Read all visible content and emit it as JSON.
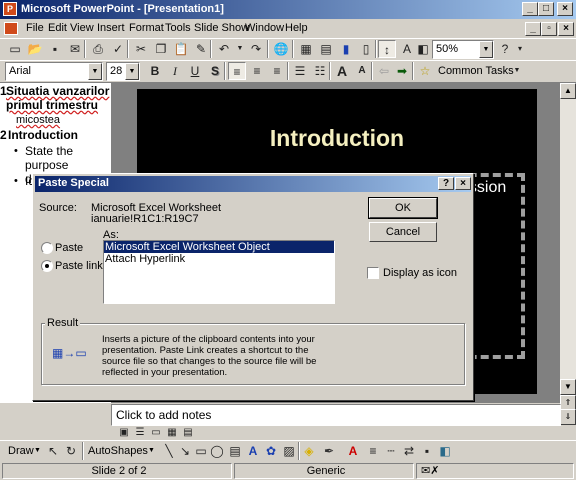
{
  "window": {
    "title": "Microsoft PowerPoint - [Presentation1]",
    "app_icon": "powerpoint-icon"
  },
  "window_controls": {
    "minimize": "_",
    "maximize": "□",
    "close": "×"
  },
  "doc_controls": {
    "minimize": "_",
    "restore": "▫",
    "close": "×"
  },
  "menu": {
    "items": [
      {
        "id": "file",
        "label": "File"
      },
      {
        "id": "edit",
        "label": "Edit"
      },
      {
        "id": "view",
        "label": "View"
      },
      {
        "id": "insert",
        "label": "Insert"
      },
      {
        "id": "format",
        "label": "Format"
      },
      {
        "id": "tools",
        "label": "Tools"
      },
      {
        "id": "slideshow",
        "label": "Slide Show"
      },
      {
        "id": "window",
        "label": "Window"
      },
      {
        "id": "help",
        "label": "Help"
      }
    ]
  },
  "standard_toolbar": {
    "zoom": "50%"
  },
  "formatting_toolbar": {
    "font": "Arial",
    "size": "28",
    "bold": "B",
    "italic": "I",
    "underline": "U",
    "shadow": "S",
    "common_tasks": "Common Tasks"
  },
  "outline": {
    "slide1_num": "1",
    "slide1_title": "Situatia vanzarilor primul trimestru",
    "slide1_sub": "micostea",
    "slide2_num": "2",
    "slide2_title": "Introduction",
    "bullet1": "State the purpose discussion",
    "bullet2": "Id"
  },
  "slide": {
    "title": "Introduction",
    "partial_text": "cussion"
  },
  "notes": {
    "placeholder": "Click to add notes"
  },
  "draw_toolbar": {
    "draw": "Draw",
    "autoshapes": "AutoShapes"
  },
  "status": {
    "slide_info": "Slide 2 of 2",
    "design": "Generic"
  },
  "dialog": {
    "title": "Paste Special",
    "help": "?",
    "close": "×",
    "source_label": "Source:",
    "source_line1": "Microsoft Excel Worksheet",
    "source_line2": "ianuarie!R1C1:R19C7",
    "as_label": "As:",
    "options": [
      "Paste",
      "Paste link"
    ],
    "selected_option": "Paste link",
    "as_items": [
      "Microsoft Excel Worksheet Object",
      "Attach Hyperlink"
    ],
    "selected_item": "Microsoft Excel Worksheet Object",
    "ok": "OK",
    "cancel": "Cancel",
    "display_as_icon": "Display as icon",
    "result_label": "Result",
    "result_text": "Inserts a picture of the clipboard contents into your presentation. Paste Link creates a shortcut to the source file so that changes to the source file will be reflected in your presentation."
  },
  "colors": {
    "titlebar": "#0a246a",
    "selection": "#0a246a",
    "slide_bg": "#000000",
    "slide_title": "#f5f0c0"
  }
}
